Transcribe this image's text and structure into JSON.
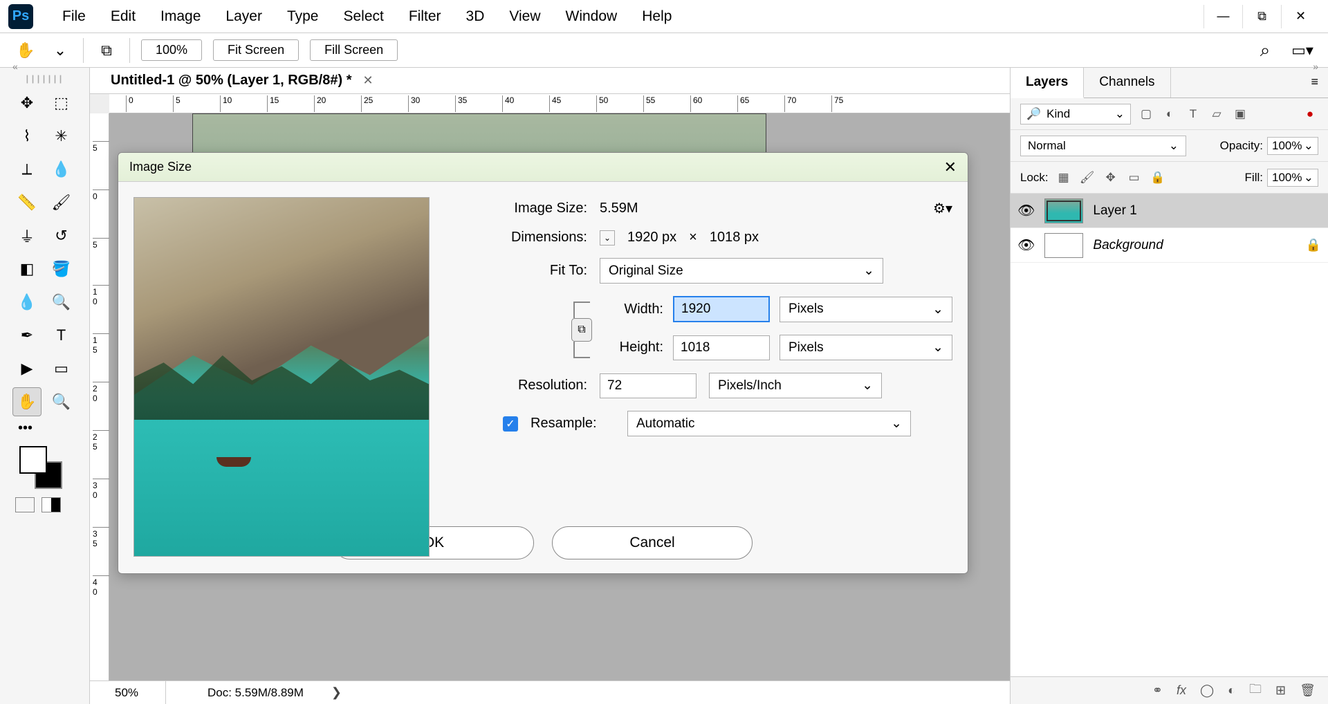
{
  "menubar": {
    "items": [
      "File",
      "Edit",
      "Image",
      "Layer",
      "Type",
      "Select",
      "Filter",
      "3D",
      "View",
      "Window",
      "Help"
    ]
  },
  "optbar": {
    "zoom_value": "100%",
    "fit_screen": "Fit Screen",
    "fill_screen": "Fill Screen"
  },
  "document": {
    "tab_title": "Untitled-1 @ 50% (Layer 1, RGB/8#) *",
    "status_zoom": "50%",
    "status_doc": "Doc: 5.59M/8.89M"
  },
  "ruler_h": [
    "0",
    "5",
    "10",
    "15",
    "20",
    "25",
    "30",
    "35",
    "40",
    "45",
    "50",
    "55",
    "60",
    "65",
    "70",
    "75"
  ],
  "ruler_v": [
    "5",
    "0",
    "5",
    "0",
    "1",
    "5",
    "2",
    "0",
    "2",
    "5",
    "3",
    "0",
    "3",
    "5",
    "4",
    "0"
  ],
  "panels": {
    "tabs": [
      "Layers",
      "Channels"
    ],
    "kind_label": "Kind",
    "blend_mode": "Normal",
    "opacity_label": "Opacity:",
    "opacity_value": "100%",
    "lock_label": "Lock:",
    "fill_label": "Fill:",
    "fill_value": "100%",
    "layers": [
      {
        "name": "Layer 1",
        "locked": false
      },
      {
        "name": "Background",
        "locked": true
      }
    ]
  },
  "dialog": {
    "title": "Image Size",
    "imagesize_label": "Image Size:",
    "imagesize_value": "5.59M",
    "dimensions_label": "Dimensions:",
    "dim_w": "1920 px",
    "dim_sep": "×",
    "dim_h": "1018 px",
    "fitto_label": "Fit To:",
    "fitto_value": "Original Size",
    "width_label": "Width:",
    "width_value": "1920",
    "width_unit": "Pixels",
    "height_label": "Height:",
    "height_value": "1018",
    "height_unit": "Pixels",
    "resolution_label": "Resolution:",
    "resolution_value": "72",
    "resolution_unit": "Pixels/Inch",
    "resample_label": "Resample:",
    "resample_value": "Automatic",
    "ok": "OK",
    "cancel": "Cancel"
  }
}
